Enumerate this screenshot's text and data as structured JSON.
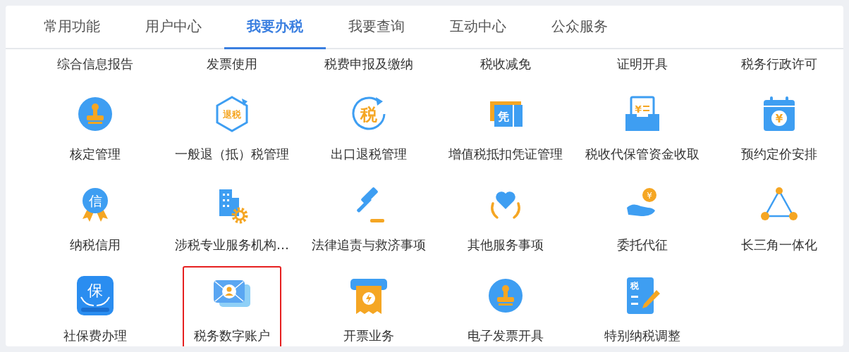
{
  "tabs": [
    {
      "label": "常用功能",
      "selected": false
    },
    {
      "label": "用户中心",
      "selected": false
    },
    {
      "label": "我要办税",
      "selected": true
    },
    {
      "label": "我要查询",
      "selected": false
    },
    {
      "label": "互动中心",
      "selected": false
    },
    {
      "label": "公众服务",
      "selected": false
    }
  ],
  "rows": [
    {
      "items": [
        {
          "label": "综合信息报告",
          "highlighted": false
        },
        {
          "label": "发票使用",
          "highlighted": false
        },
        {
          "label": "税费申报及缴纳",
          "highlighted": false
        },
        {
          "label": "税收减免",
          "highlighted": false
        },
        {
          "label": "证明开具",
          "highlighted": false
        },
        {
          "label": "税务行政许可",
          "highlighted": false
        }
      ]
    },
    {
      "items": [
        {
          "label": "核定管理",
          "kind": "stamp",
          "highlighted": false
        },
        {
          "label": "一般退（抵）税管理",
          "kind": "refund-hex",
          "glyph": "退税",
          "highlighted": false
        },
        {
          "label": "出口退税管理",
          "kind": "tax-circle",
          "glyph": "税",
          "highlighted": false
        },
        {
          "label": "增值税抵扣凭证管理",
          "kind": "voucher",
          "glyph": "凭",
          "highlighted": false
        },
        {
          "label": "税收代保管资金收取",
          "kind": "tray",
          "glyph": "¥",
          "highlighted": false
        },
        {
          "label": "预约定价安排",
          "kind": "calendar",
          "glyph": "¥",
          "highlighted": false
        }
      ]
    },
    {
      "items": [
        {
          "label": "纳税信用",
          "kind": "medal",
          "glyph": "信",
          "highlighted": false
        },
        {
          "label": "涉税专业服务机构…",
          "kind": "building-gear",
          "highlighted": false
        },
        {
          "label": "法律追责与救济事项",
          "kind": "gavel",
          "highlighted": false
        },
        {
          "label": "其他服务事项",
          "kind": "heart-hands",
          "highlighted": false
        },
        {
          "label": "委托代征",
          "kind": "hand-coin",
          "glyph": "¥",
          "highlighted": false
        },
        {
          "label": "长三角一体化",
          "kind": "triangle",
          "highlighted": false
        }
      ]
    },
    {
      "items": [
        {
          "label": "社保费办理",
          "kind": "app-bao",
          "glyph": "保",
          "highlighted": false
        },
        {
          "label": "税务数字账户",
          "kind": "envelope-person",
          "highlighted": true
        },
        {
          "label": "开票业务",
          "kind": "ticket-bolt",
          "highlighted": false
        },
        {
          "label": "电子发票开具",
          "kind": "stamp",
          "highlighted": false
        },
        {
          "label": "特别纳税调整",
          "kind": "doc-pen",
          "glyph": "税",
          "highlighted": false
        }
      ]
    }
  ]
}
